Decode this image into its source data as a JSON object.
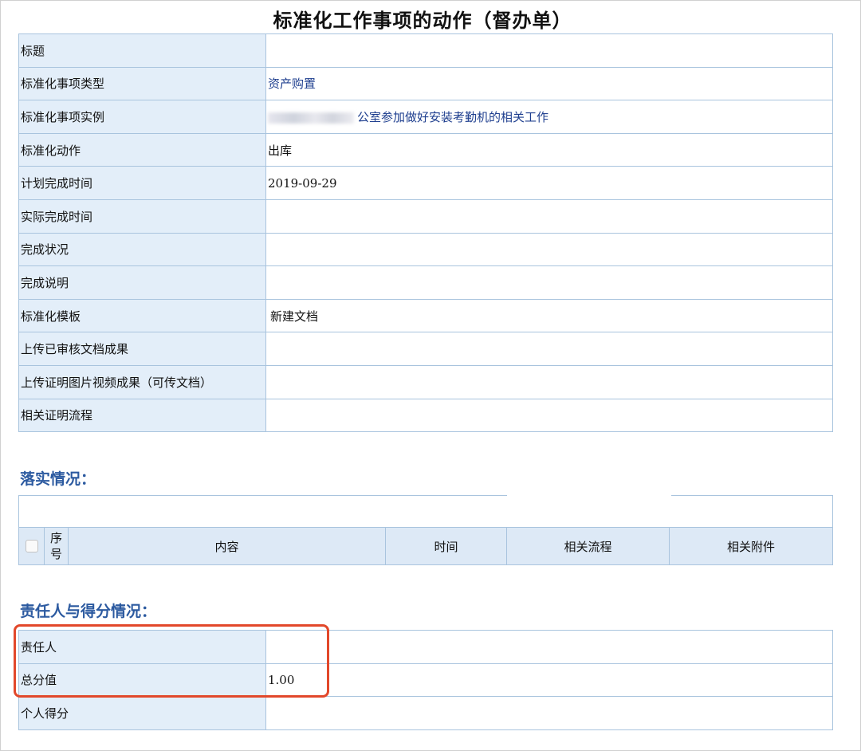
{
  "page_title": "标准化工作事项的动作（督办单）",
  "form_rows": [
    {
      "label": "标题",
      "value": ""
    },
    {
      "label": "标准化事项类型",
      "value": "资产购置"
    },
    {
      "label": "标准化事项实例",
      "value": "公室参加做好安装考勤机的相关工作"
    },
    {
      "label": "标准化动作",
      "value": "出库"
    },
    {
      "label": "计划完成时间",
      "value": "2019-09-29"
    },
    {
      "label": "实际完成时间",
      "value": ""
    },
    {
      "label": "完成状况",
      "value": ""
    },
    {
      "label": "完成说明",
      "value": ""
    },
    {
      "label": "标准化模板",
      "value": "新建文档"
    },
    {
      "label": "上传已审核文档成果",
      "value": ""
    },
    {
      "label": "上传证明图片视频成果（可传文档）",
      "value": ""
    },
    {
      "label": "相关证明流程",
      "value": ""
    }
  ],
  "implementation": {
    "title": "落实情况：",
    "columns": {
      "seq": "序号",
      "content": "内容",
      "time": "时间",
      "process": "相关流程",
      "attachment": "相关附件"
    }
  },
  "responsibility": {
    "title": "责任人与得分情况：",
    "rows": [
      {
        "label": "责任人",
        "value": ""
      },
      {
        "label": "总分值",
        "value": "1.00"
      },
      {
        "label": "个人得分",
        "value": ""
      }
    ]
  },
  "colors": {
    "label_bg": "#e3eef9",
    "border": "#a9c4de",
    "section_title": "#2c5aa0",
    "link": "#1f3f8f",
    "highlight": "#e2482b"
  }
}
